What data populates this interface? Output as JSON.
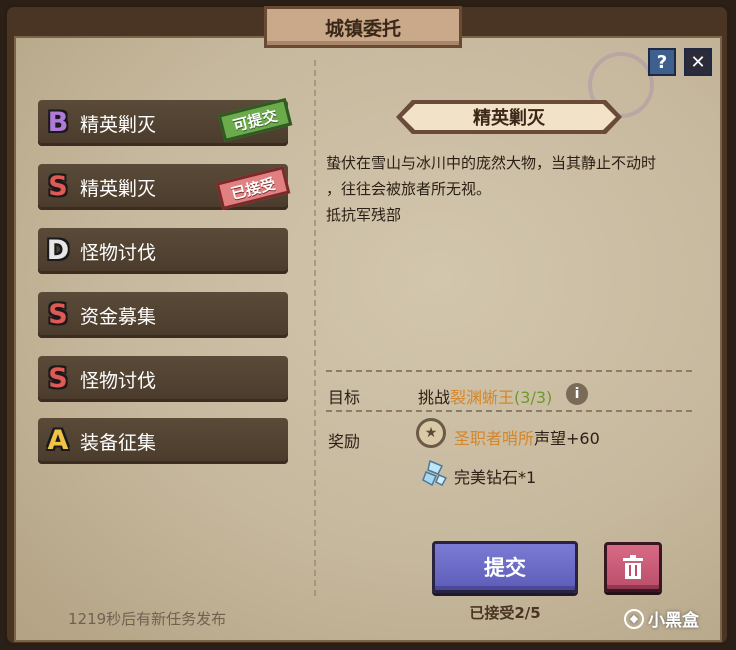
{
  "window": {
    "title": "城镇委托"
  },
  "controls": {
    "help_label": "?",
    "close_label": "✕"
  },
  "quests": [
    {
      "grade": "B",
      "name": "精英剿灭",
      "stamp": "可提交"
    },
    {
      "grade": "S",
      "name": "精英剿灭",
      "stamp": "已接受"
    },
    {
      "grade": "D",
      "name": "怪物讨伐"
    },
    {
      "grade": "S",
      "name": "资金募集"
    },
    {
      "grade": "S",
      "name": "怪物讨伐"
    },
    {
      "grade": "A",
      "name": "装备征集"
    }
  ],
  "detail": {
    "title": "精英剿灭",
    "desc_line1": "蛰伏在雪山与冰川中的庞然大物，当其静止不动时",
    "desc_line2": "，往往会被旅者所无视。",
    "desc_line3": "抵抗军残部",
    "target_label": "目标",
    "target_prefix": "挑战",
    "target_name": "裂渊蜥王",
    "target_progress": "(3/3)",
    "reward_label": "奖励",
    "reward1_faction": "圣职者哨所",
    "reward1_suffix": "声望+60",
    "reward2": "完美钻石*1"
  },
  "actions": {
    "submit_label": "提交",
    "accepted_status": "已接受2/5"
  },
  "footer": {
    "timer_text": "1219秒后有新任务发布",
    "watermark": "小黑盒"
  },
  "colors": {
    "grade_B": "#b07ad8",
    "grade_S": "#e05a55",
    "grade_D": "#e6e6e6",
    "grade_A": "#f0c24a",
    "submit": "#6b6ac6",
    "delete": "#c95a75"
  },
  "icons": {
    "help": "question-icon",
    "close": "close-icon",
    "info": "info-icon",
    "reputation": "medal-icon",
    "diamond": "diamond-icon",
    "delete": "trash-icon"
  }
}
